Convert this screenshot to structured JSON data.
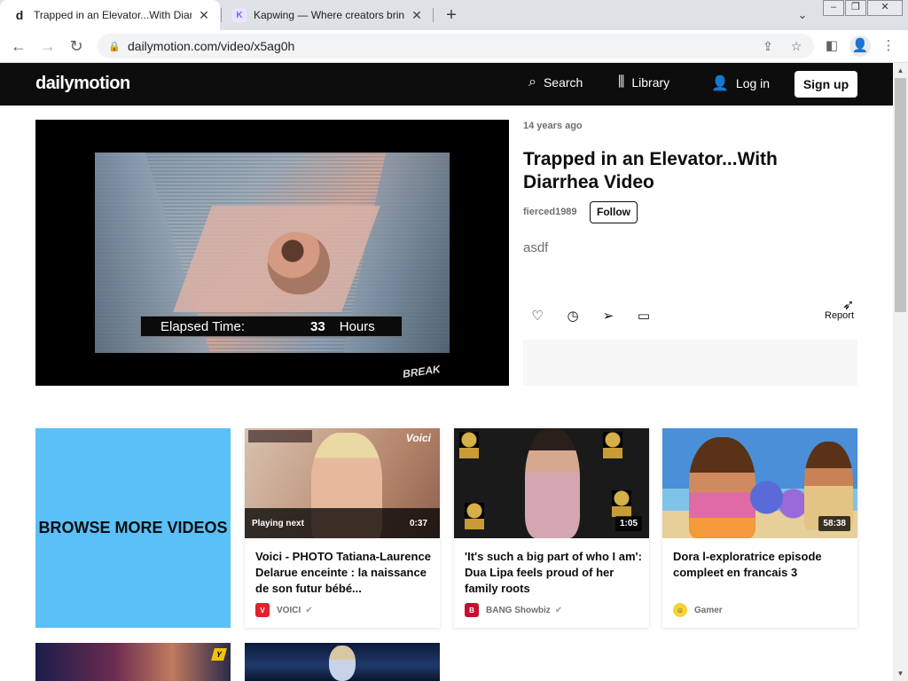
{
  "browser": {
    "tabs": [
      {
        "favicon": "d",
        "title": "Trapped in an Elevator...With Diarrhea Video",
        "active": true
      },
      {
        "favicon": "kapwing-icon",
        "title": "Kapwing — Where creators bring stories to life",
        "active": false
      }
    ],
    "url": "dailymotion.com/video/x5ag0h"
  },
  "header": {
    "logo": "dailymotion",
    "search_label": "Search",
    "library_label": "Library",
    "login_label": "Log in",
    "signup_label": "Sign up"
  },
  "player": {
    "caption_label": "Elapsed Time:",
    "caption_value": "33",
    "caption_unit": "Hours",
    "watermark": "BREAK"
  },
  "video": {
    "time_ago": "14 years ago",
    "title": "Trapped in an Elevator...With Diarrhea Video",
    "channel": "fierced1989",
    "follow_label": "Follow",
    "description": "asdf",
    "report_label": "Report"
  },
  "grid": {
    "browse_label": "BROWSE MORE VIDEOS",
    "cards": [
      {
        "title": "Voici - PHOTO Tatiana-Laurence Delarue enceinte : la naissance de son futur bébé...",
        "source": "VOICI",
        "avatar_text": "Voici",
        "avatar_color": "#e4202c",
        "overlay": "Playing next",
        "duration": "0:37",
        "verified": true
      },
      {
        "title": "'It's such a big part of who I am': Dua Lipa feels proud of her family roots",
        "source": "BANG Showbiz",
        "avatar_text": "B",
        "avatar_color": "#c8102e",
        "duration": "1:05",
        "verified": true
      },
      {
        "title": "Dora l-exploratrice episode compleet en francais 3",
        "source": "Gamer",
        "avatar_text": "☺",
        "avatar_color": "#f6d23a",
        "duration": "58:38",
        "verified": false
      }
    ],
    "row2_badge": "Y"
  },
  "colors": {
    "header_bg": "#0d0d0d",
    "browse_bg": "#5bc0f8",
    "text_muted": "#6e6e6e"
  }
}
